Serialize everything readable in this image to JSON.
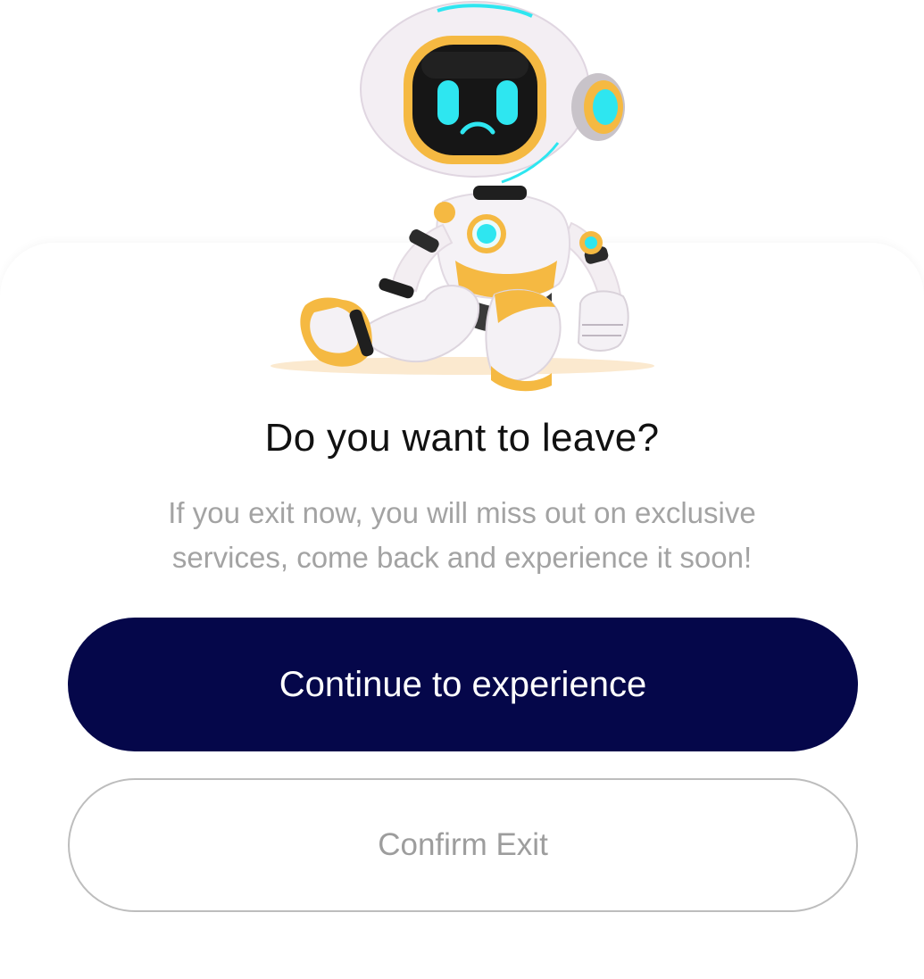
{
  "dialog": {
    "title": "Do you want to leave?",
    "message": "If you exit now, you will miss out on exclusive services, come back and experience it soon!",
    "primary_button_label": "Continue to experience",
    "secondary_button_label": "Confirm Exit"
  },
  "illustration": {
    "icon": "sad-robot-icon"
  },
  "colors": {
    "primary_button": "#05074a",
    "primary_text": "#ffffff",
    "title_text": "#111111",
    "message_text": "#a3a3a3",
    "secondary_border": "#bdbdbd",
    "robot_accent": "#f5b942",
    "robot_face_glow": "#2ee6f0"
  }
}
